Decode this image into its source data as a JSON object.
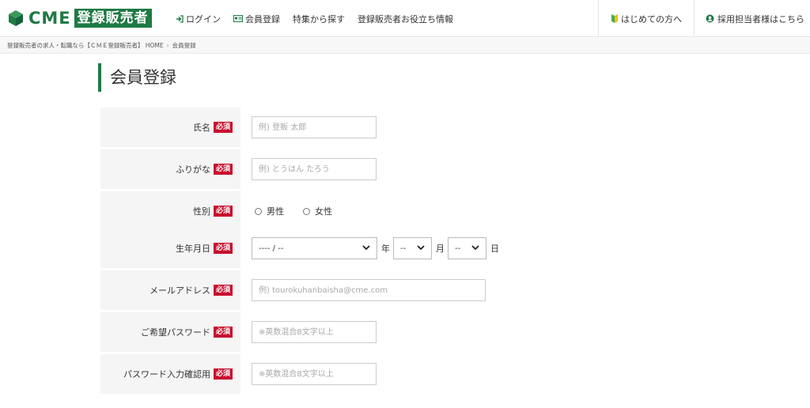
{
  "header": {
    "logo_cme": "CME",
    "logo_badge": "登録販売者",
    "nav": [
      {
        "label": "ログイン",
        "icon": "login-icon"
      },
      {
        "label": "会員登録",
        "icon": "id-card-icon"
      },
      {
        "label": "特集から探す"
      },
      {
        "label": "登録販売者お役立ち情報"
      }
    ],
    "beginner": "はじめての方へ",
    "employer": "採用担当者様はこちら"
  },
  "breadcrumb": {
    "home": "登録販売者の求人・転職なら【ＣＭＥ登録販売者】 HOME",
    "sep": "›",
    "current": "会員登録"
  },
  "page_title": "会員登録",
  "form": {
    "required_label": "必須",
    "name_label": "氏名",
    "name_placeholder": "例) 登販 太郎",
    "kana_label": "ふりがな",
    "kana_placeholder": "例) とうはん たろう",
    "gender_label": "性別",
    "gender_male": "男性",
    "gender_female": "女性",
    "birth_label": "生年月日",
    "birth_year_value": "---- / --",
    "birth_year_unit": "年",
    "birth_month_value": "--",
    "birth_month_unit": "月",
    "birth_day_value": "--",
    "birth_day_unit": "日",
    "email_label": "メールアドレス",
    "email_placeholder": "例) tourokuhanbaisha@cme.com",
    "password_label": "ご希望パスワード",
    "password_placeholder": "※英数混合8文字以上",
    "password_confirm_label": "パスワード入力確認用",
    "password_confirm_placeholder": "※英数混合8文字以上"
  },
  "colors": {
    "brand_green": "#1f7a44",
    "required_red": "#c8102e"
  }
}
